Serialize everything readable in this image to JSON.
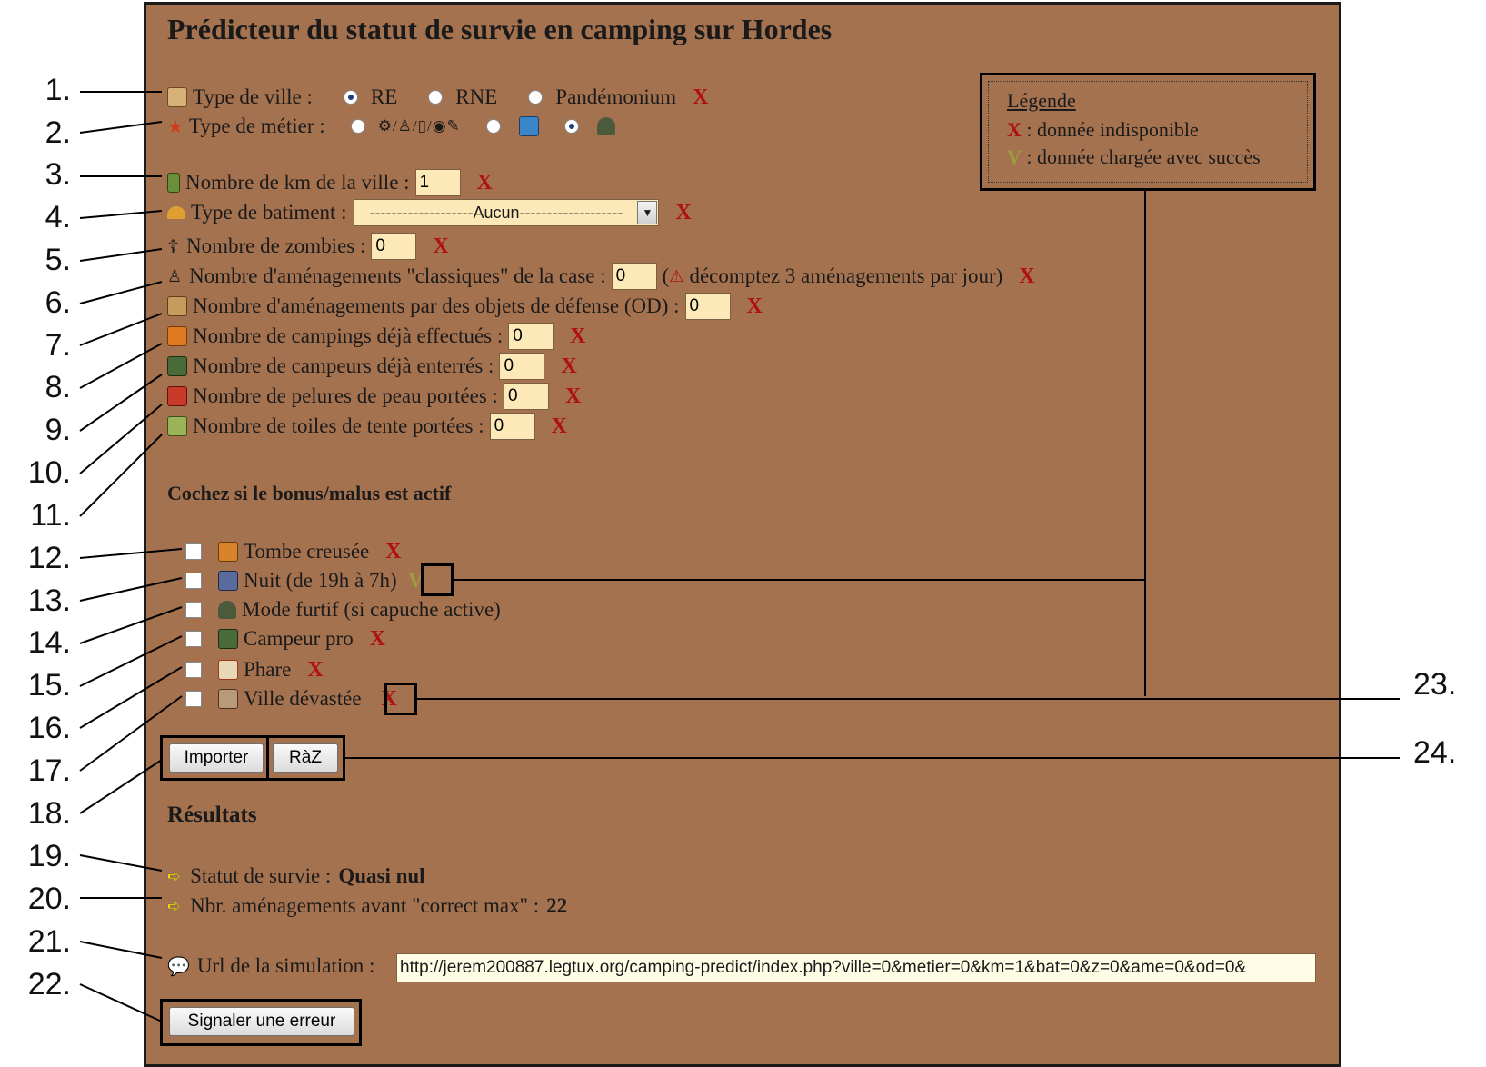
{
  "title": "Prédicteur du statut de survie en camping sur Hordes",
  "numbers": [
    "1.",
    "2.",
    "3.",
    "4.",
    "5.",
    "6.",
    "7.",
    "8.",
    "9.",
    "10.",
    "11.",
    "12.",
    "13.",
    "14.",
    "15.",
    "16.",
    "17.",
    "18.",
    "19.",
    "20.",
    "21.",
    "22.",
    "23.",
    "24."
  ],
  "legend": {
    "title": "Légende",
    "x_symbol": "X",
    "x_text": ": donnée indisponible",
    "v_symbol": "V",
    "v_text": ": donnée chargée avec succès"
  },
  "fields": {
    "ville_label": "Type de ville :",
    "ville_options": [
      "RE",
      "RNE",
      "Pandémonium"
    ],
    "metier_label": "Type de métier :",
    "km_label": "Nombre de km de la ville :",
    "km_value": "1",
    "bat_label": "Type de batiment :",
    "bat_value": "-------------------Aucun-------------------",
    "z_label": "Nombre de zombies :",
    "z_value": "0",
    "ame_label": "Nombre d'aménagements \"classiques\" de la case :",
    "ame_value": "0",
    "ame_note": "décomptez 3 aménagements par jour)",
    "od_label": "Nombre d'aménagements par des objets de défense (OD) :",
    "od_value": "0",
    "camp_label": "Nombre de campings déjà effectués :",
    "camp_value": "0",
    "enter_label": "Nombre de campeurs déjà enterrés :",
    "enter_value": "0",
    "pelure_label": "Nombre de pelures de peau portées :",
    "pelure_value": "0",
    "toile_label": "Nombre de toiles de tente portées :",
    "toile_value": "0",
    "x": "X"
  },
  "bonus": {
    "heading": "Cochez si le bonus/malus est actif",
    "items": [
      {
        "label": "Tombe creusée",
        "status": "X"
      },
      {
        "label": "Nuit (de 19h à 7h)",
        "status": "V"
      },
      {
        "label": "Mode furtif (si capuche active)",
        "status": ""
      },
      {
        "label": "Campeur pro",
        "status": "X"
      },
      {
        "label": "Phare",
        "status": "X"
      },
      {
        "label": "Ville dévastée",
        "status": "X"
      }
    ]
  },
  "buttons": {
    "import": "Importer",
    "reset": "RàZ",
    "report": "Signaler une erreur"
  },
  "results": {
    "heading": "Résultats",
    "survie_label": "Statut de survie :",
    "survie_value": "Quasi nul",
    "ame_label": "Nbr. aménagements avant \"correct max\" :",
    "ame_value": "22",
    "url_label": "Url de la simulation :",
    "url_value": "http://jerem200887.legtux.org/camping-predict/index.php?ville=0&metier=0&km=1&bat=0&z=0&ame=0&od=0&"
  },
  "colors": {
    "panel": "#a57250",
    "input": "#fde8b8",
    "x": "#b01010",
    "v": "#9aa03c"
  }
}
